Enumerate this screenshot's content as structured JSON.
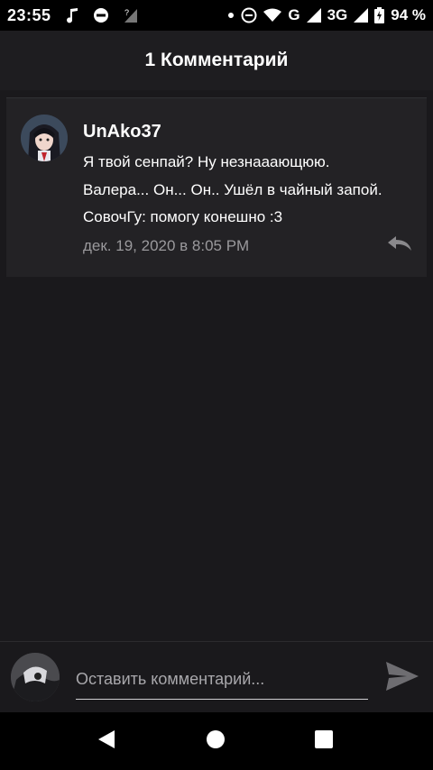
{
  "status_bar": {
    "time": "23:55",
    "network_label": "G",
    "network_label_2": "3G",
    "battery_percent": "94 %",
    "icons": [
      "music-note-icon",
      "dnd-icon",
      "no-signal-icon",
      "dot-icon",
      "dnd-icon",
      "wifi-icon",
      "signal-icon",
      "signal-icon",
      "battery-charging-icon"
    ]
  },
  "header": {
    "title": "1 Комментарий"
  },
  "comment": {
    "author": "UnAko37",
    "lines": [
      "Я твой сенпай? Ну незнааающюю.",
      "Валера... Он... Он.. Ушёл в чайный запой.",
      "СовочГу: помогу конешно :3"
    ],
    "date": "дек. 19, 2020 в 8:05 PM",
    "reply_icon": "reply-icon"
  },
  "composer": {
    "placeholder": "Оставить комментарий...",
    "value": "",
    "send_icon": "send-icon"
  },
  "nav_bar": {
    "icons": [
      "back-icon",
      "home-icon",
      "recents-icon"
    ]
  },
  "colors": {
    "background": "#1a191c",
    "card": "#232225",
    "muted_text": "#9a999c"
  }
}
